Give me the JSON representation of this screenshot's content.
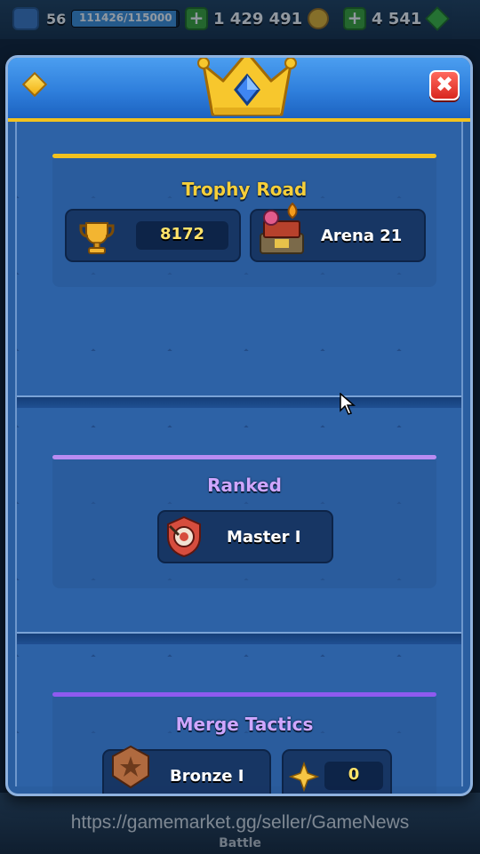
{
  "topbar": {
    "level": "56",
    "xp_text": "111426/115000",
    "xp_progress": 0.969,
    "gold": "1 429 491",
    "gems": "4 541"
  },
  "modal": {
    "close_label": "✖",
    "sections": {
      "trophy_road": {
        "title": "Trophy Road",
        "trophies": "8172",
        "arena": "Arena 21",
        "accent": "#f2c21f"
      },
      "ranked": {
        "title": "Ranked",
        "league": "Master I",
        "accent": "#b98cf2"
      },
      "merge_tactics": {
        "title": "Merge Tactics",
        "rank": "Bronze I",
        "stars": "0",
        "accent": "#8f5af0"
      }
    }
  },
  "footer": {
    "watermark": "https://gamemarket.gg/seller/GameNews",
    "nav_label": "Battle"
  }
}
